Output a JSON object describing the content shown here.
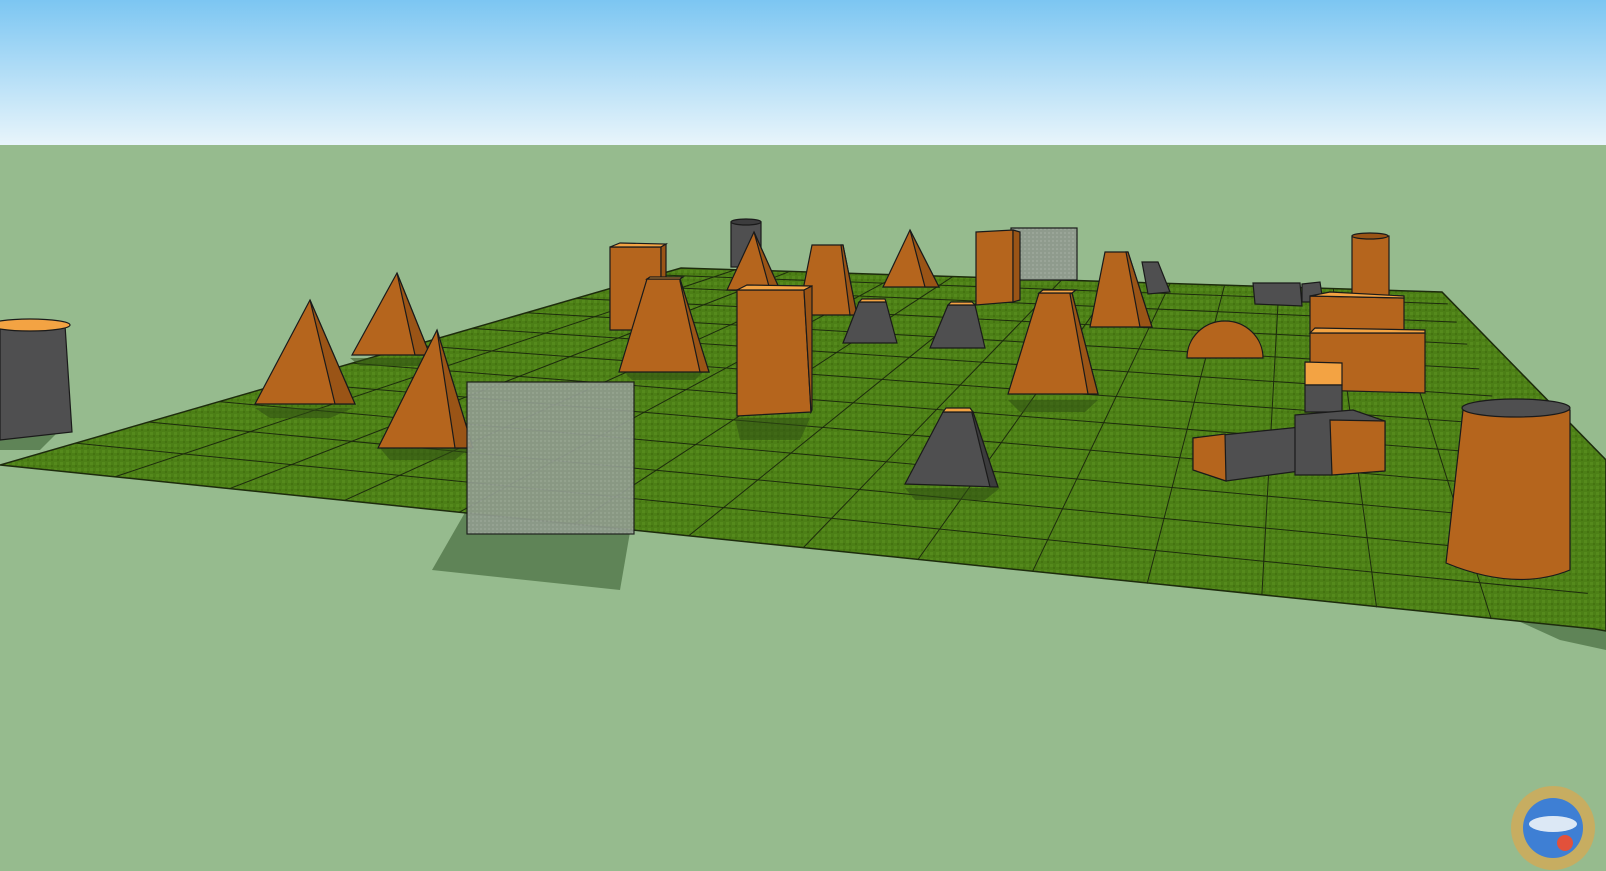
{
  "scene": {
    "sky_top": "#7cc6f2",
    "sky_bottom": "#e9f5fb",
    "ground": "#96bb8e",
    "field": "#4c7f16",
    "field_light": "#578c1f",
    "grid_line": "#1d2b0d",
    "orange": "#b5651d",
    "orange_dark": "#9a5416",
    "orange_top": "#f3a343",
    "gray": "#4f4f50",
    "gray_dark": "#3c3c3d",
    "glass": "#8e9a8c",
    "shadow": "#46683f",
    "outline": "#1a1a1a"
  },
  "watermark": {
    "icon": "globe-logo-icon"
  }
}
